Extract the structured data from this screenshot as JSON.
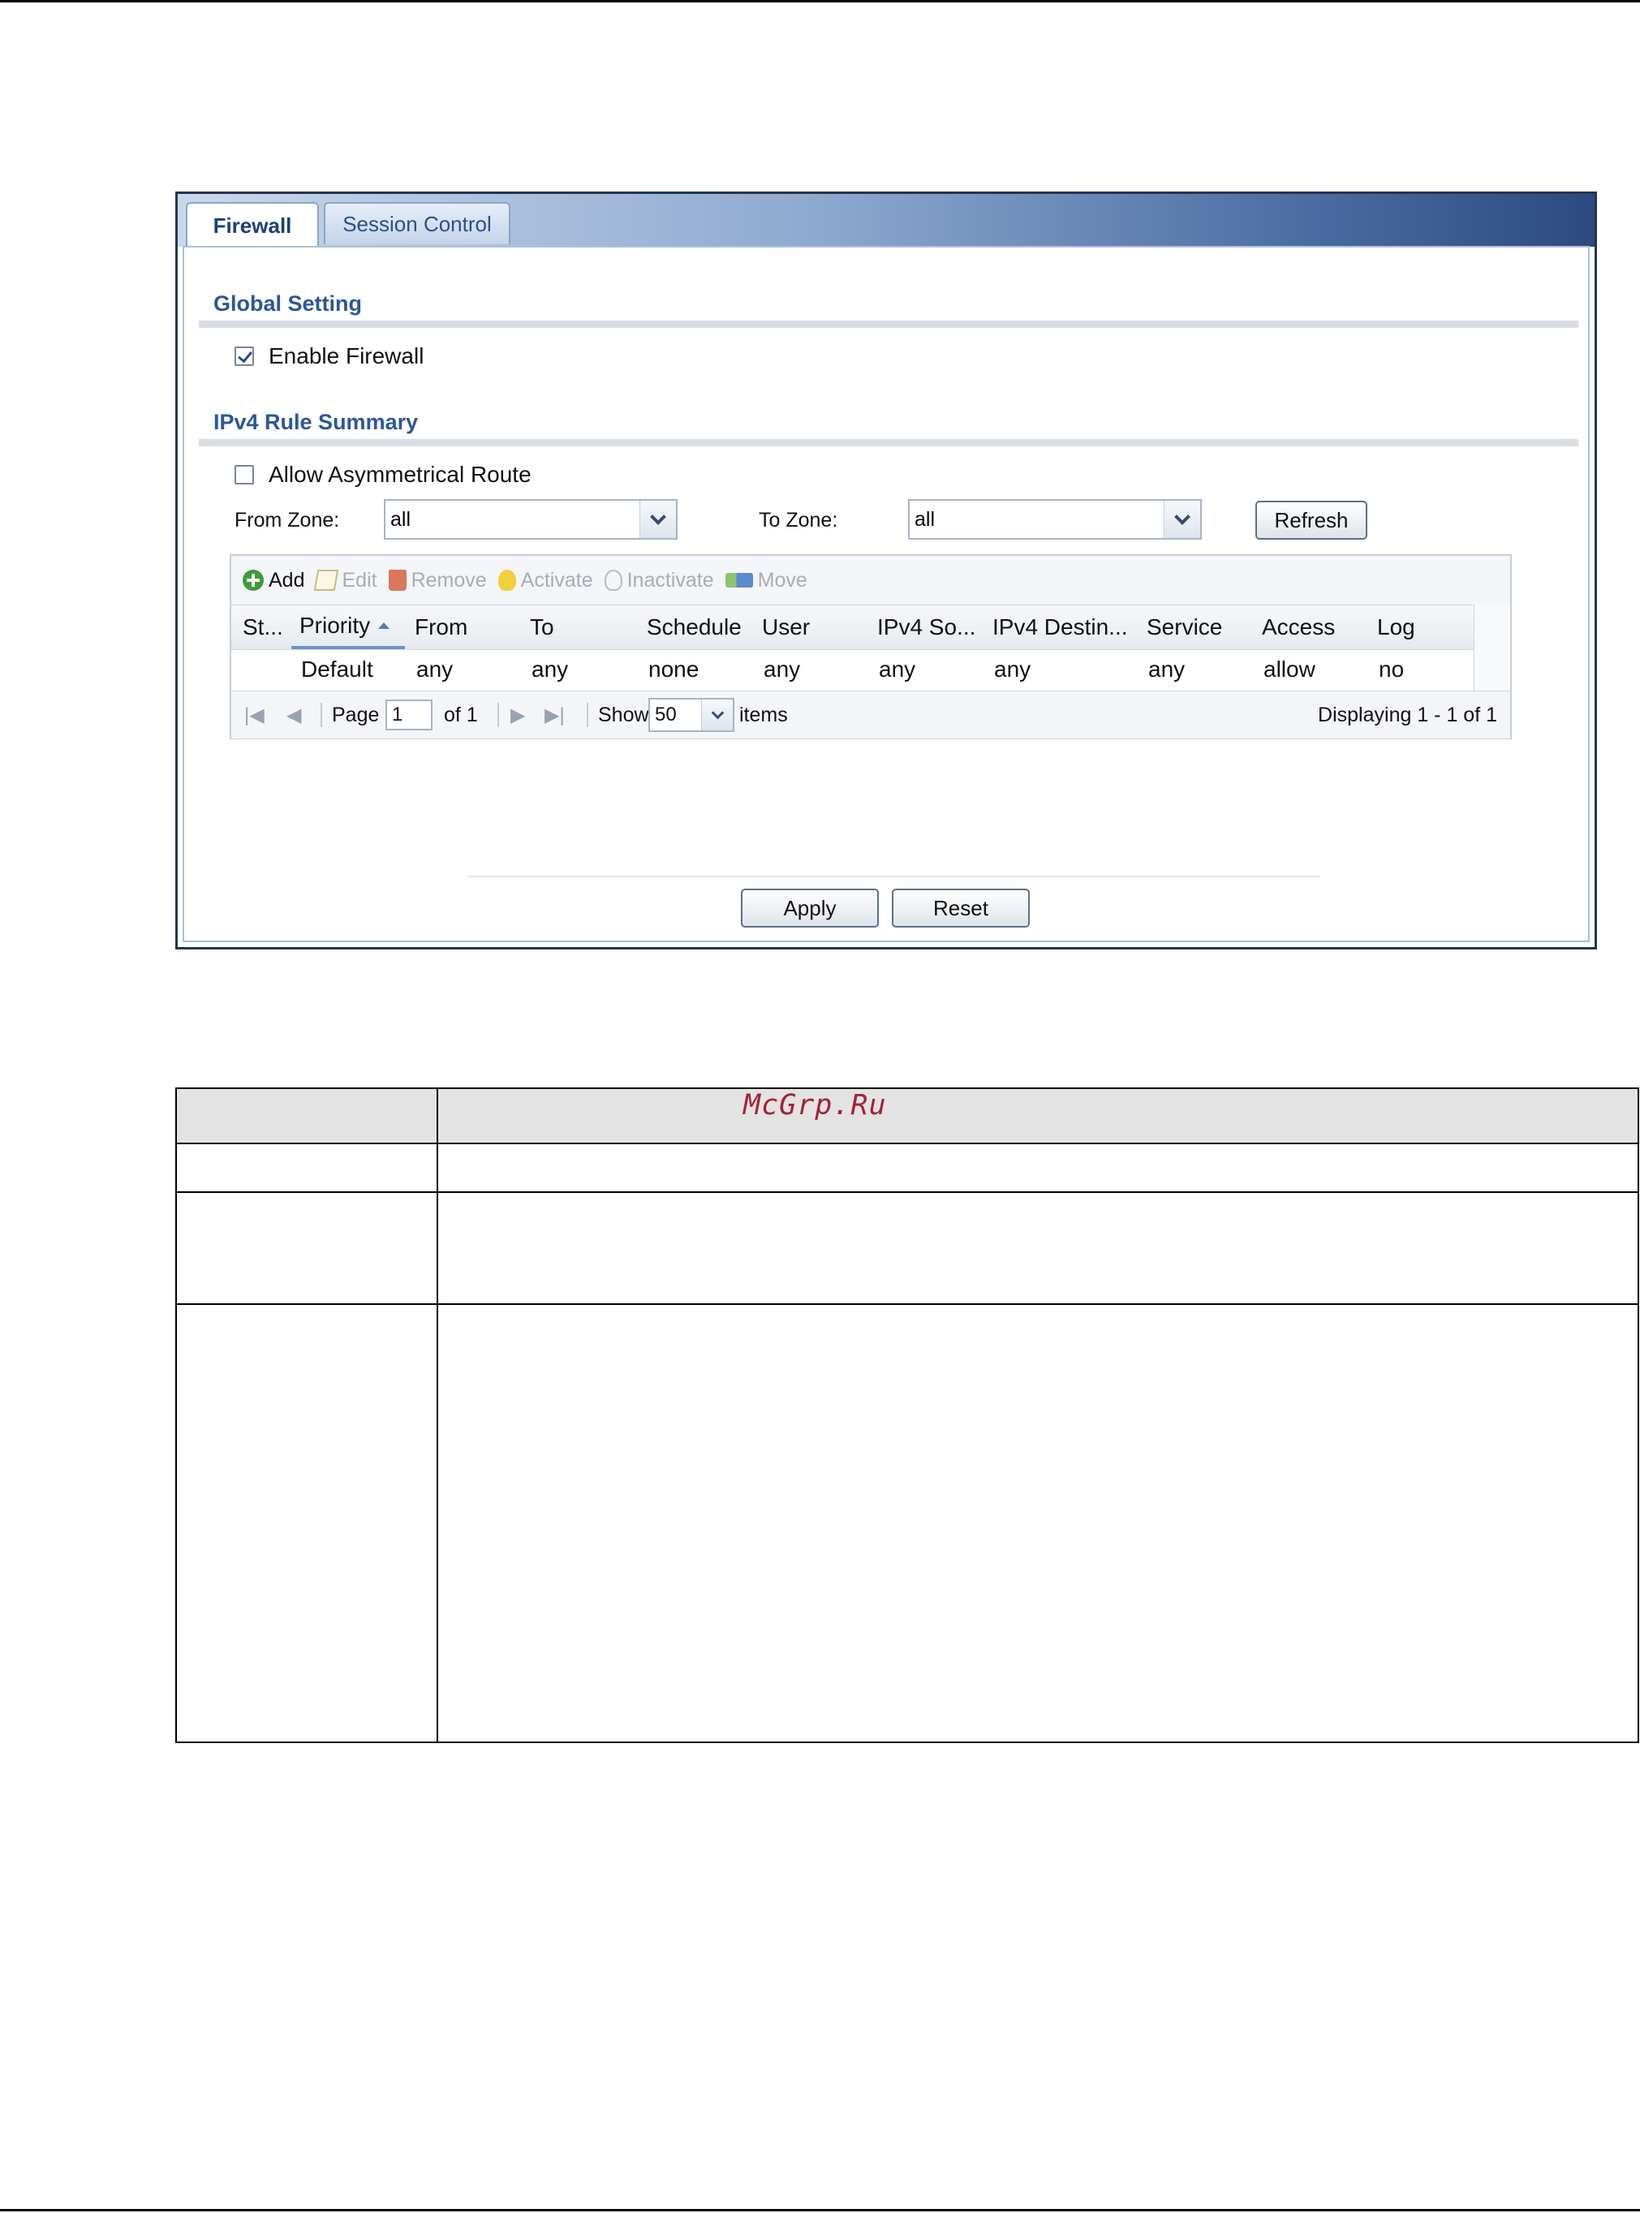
{
  "tabs": [
    {
      "label": "Firewall",
      "active": true
    },
    {
      "label": "Session Control",
      "active": false
    }
  ],
  "global_setting": {
    "title": "Global Setting",
    "enable_firewall": {
      "label": "Enable Firewall",
      "checked": true
    }
  },
  "ipv4_summary": {
    "title": "IPv4 Rule Summary",
    "asymmetrical": {
      "label": "Allow Asymmetrical Route",
      "checked": false
    },
    "from_zone": {
      "label": "From Zone:",
      "value": "all"
    },
    "to_zone": {
      "label": "To Zone:",
      "value": "all"
    },
    "refresh_label": "Refresh"
  },
  "toolbar": {
    "add": "Add",
    "edit": "Edit",
    "remove": "Remove",
    "activate": "Activate",
    "inactivate": "Inactivate",
    "move": "Move"
  },
  "table": {
    "columns": [
      "St...",
      "Priority",
      "From",
      "To",
      "Schedule",
      "User",
      "IPv4 So...",
      "IPv4 Destin...",
      "Service",
      "Access",
      "Log"
    ],
    "sorted_column": "Priority",
    "rows": [
      [
        "",
        "Default",
        "any",
        "any",
        "none",
        "any",
        "any",
        "any",
        "any",
        "allow",
        "no"
      ]
    ]
  },
  "pager": {
    "page_label": "Page",
    "page_value": "1",
    "of_label": "of 1",
    "show_label": "Show",
    "show_value": "50",
    "items_label": "items",
    "displaying": "Displaying 1 - 1 of 1"
  },
  "buttons": {
    "apply": "Apply",
    "reset": "Reset"
  },
  "colors": {
    "tab_gradient_end": "#2c4a7f",
    "section_title": "#2b5797",
    "watermark": "#a3223c"
  },
  "watermark": "McGrp.Ru"
}
